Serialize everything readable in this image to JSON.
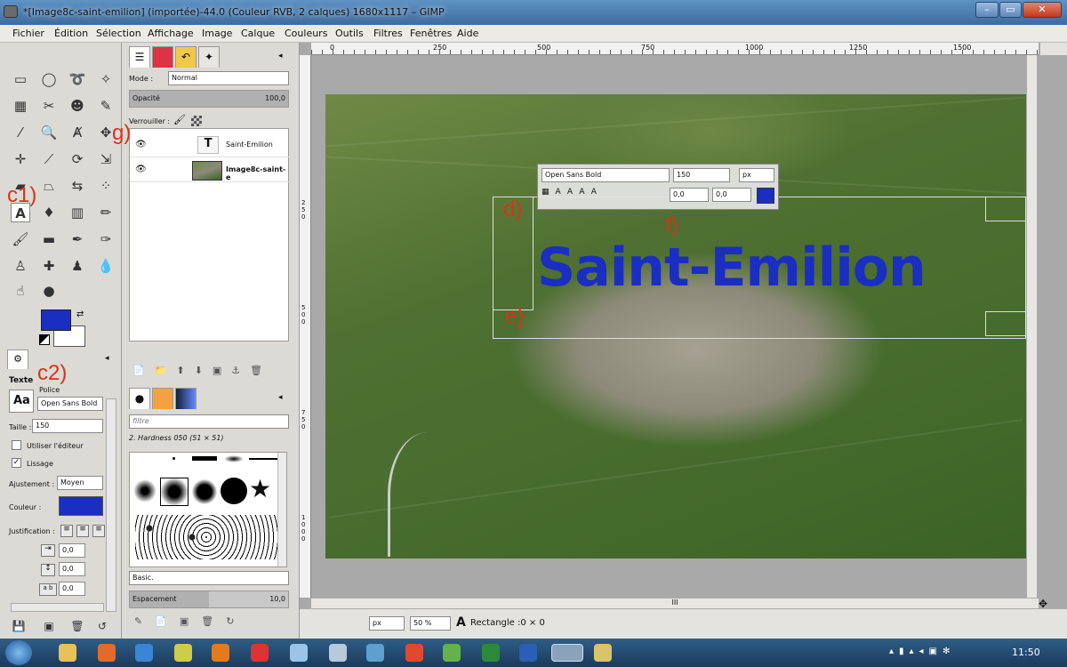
{
  "window": {
    "title": "*[Image8c-saint-emilion] (importée)-44.0 (Couleur RVB, 2 calques) 1680x1117 – GIMP",
    "min": "–",
    "max": "▭",
    "close": "✕"
  },
  "menu": [
    "Fichier",
    "Édition",
    "Sélection",
    "Affichage",
    "Image",
    "Calque",
    "Couleurs",
    "Outils",
    "Filtres",
    "Fenêtres",
    "Aide"
  ],
  "annotations": {
    "c1": "c1)",
    "c2": "c2)",
    "g": "g)",
    "d": "d)",
    "e": "e)",
    "f": "f)"
  },
  "tool_options": {
    "section": "Texte",
    "font_label": "Police",
    "font_value": "Open Sans Bold",
    "font_icon": "Aa",
    "size_label": "Taille :",
    "size_value": "150",
    "editor_label": "Utiliser l'éditeur",
    "antialias_label": "Lissage",
    "hinting_label": "Ajustement :",
    "hinting_value": "Moyen",
    "color_label": "Couleur :",
    "justify_label": "Justification :",
    "indent_value": "0,0",
    "line_value": "0,0",
    "letter_value": "0,0",
    "letter_icon": "a b",
    "text_color": "#1a2ec2"
  },
  "layers": {
    "mode_label": "Mode :",
    "mode_value": "Normal",
    "opacity_label": "Opacité",
    "opacity_value": "100,0",
    "lock_label": "Verrouiller :",
    "rows": [
      {
        "name": "Saint-Emilion",
        "type": "text"
      },
      {
        "name": "Image8c-saint-e",
        "type": "image"
      }
    ]
  },
  "brushes": {
    "filter_placeholder": "filtre",
    "current": "2. Hardness 050 (51 × 51)",
    "preset": "Basic.",
    "spacing_label": "Espacement",
    "spacing_value": "10,0"
  },
  "text_overlay": {
    "font": "Open Sans Bold",
    "size": "150",
    "unit": "px",
    "x": "0,0",
    "y": "0,0",
    "text": "Saint-Emilion",
    "color": "#1a2ec2"
  },
  "ruler": {
    "h": [
      "0",
      "250",
      "500",
      "750",
      "1000",
      "1250",
      "1500"
    ],
    "v": [
      "2 5 0",
      "5 0 0",
      "7 5 0",
      "1 0 0 0"
    ]
  },
  "status": {
    "unit": "px",
    "zoom": "50 %",
    "message": "Rectangle :0 × 0",
    "scroll_h_label": "III"
  },
  "taskbar": {
    "clock": "11:50"
  }
}
